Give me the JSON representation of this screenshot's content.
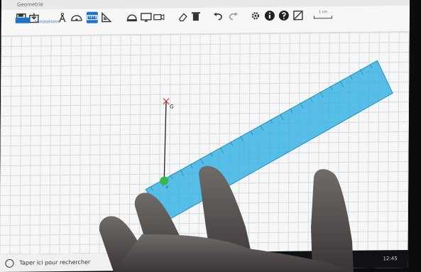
{
  "window": {
    "title": "Geometrie"
  },
  "tabs": {
    "file_label": "",
    "annotations_label": "Annotations"
  },
  "toolbar": {
    "icons": [
      "save-icon",
      "save-as-icon",
      "compass-icon",
      "protractor-icon",
      "ruler-icon",
      "set-square-icon",
      "half-protractor-icon",
      "screen-icon",
      "camera-icon",
      "eraser-icon",
      "trash-icon",
      "undo-icon",
      "redo-icon",
      "settings-icon",
      "info-icon",
      "help-icon",
      "resize-icon"
    ],
    "scale_label": "1 cm"
  },
  "canvas": {
    "point_g_label": "G",
    "point_f_label": "F"
  },
  "taskbar": {
    "search_placeholder": "Taper ici pour rechercher",
    "clock": "12:45"
  },
  "colors": {
    "ruler": "#3fb9e6",
    "accent": "#1d73c9",
    "point": "#38b84a",
    "segment": "#222222"
  }
}
